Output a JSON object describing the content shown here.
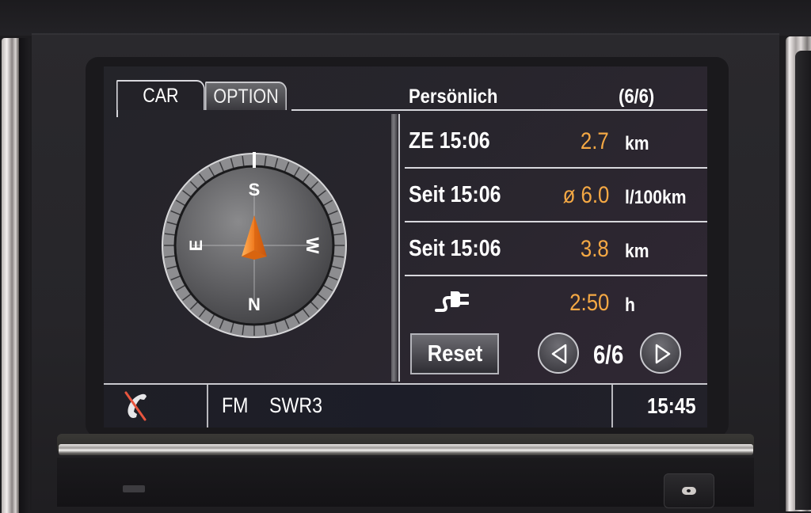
{
  "tabs": [
    {
      "label": "CAR",
      "active": true
    },
    {
      "label": "OPTION",
      "active": false
    }
  ],
  "header": {
    "title": "Persönlich",
    "page_count": "(6/6)"
  },
  "compass": {
    "labels": {
      "top": "S",
      "bottom": "N",
      "left": "E",
      "right": "W"
    },
    "heading": "S",
    "needle_color": "#f07a1e"
  },
  "trip_rows": [
    {
      "label": "ZE 15:06",
      "value": "2.7",
      "unit": "km"
    },
    {
      "label": "Seit 15:06",
      "value": "ø 6.0",
      "unit": "l/100km"
    },
    {
      "label": "Seit 15:06",
      "value": "3.8",
      "unit": "km"
    },
    {
      "icon": "ev-plug-icon",
      "value": "2:50",
      "unit": "h"
    }
  ],
  "controls": {
    "reset_label": "Reset",
    "page_indicator": "6/6",
    "prev_icon": "triangle-left-icon",
    "next_icon": "triangle-right-icon"
  },
  "status_bar": {
    "phone_icon": "phone-disconnected-icon",
    "radio_band": "FM",
    "radio_station": "SWR3",
    "clock": "15:45"
  },
  "colors": {
    "value_accent": "#f4a844",
    "text": "#ffffff",
    "screen_bg": "#26252b",
    "phone_cross": "#e8553e"
  }
}
